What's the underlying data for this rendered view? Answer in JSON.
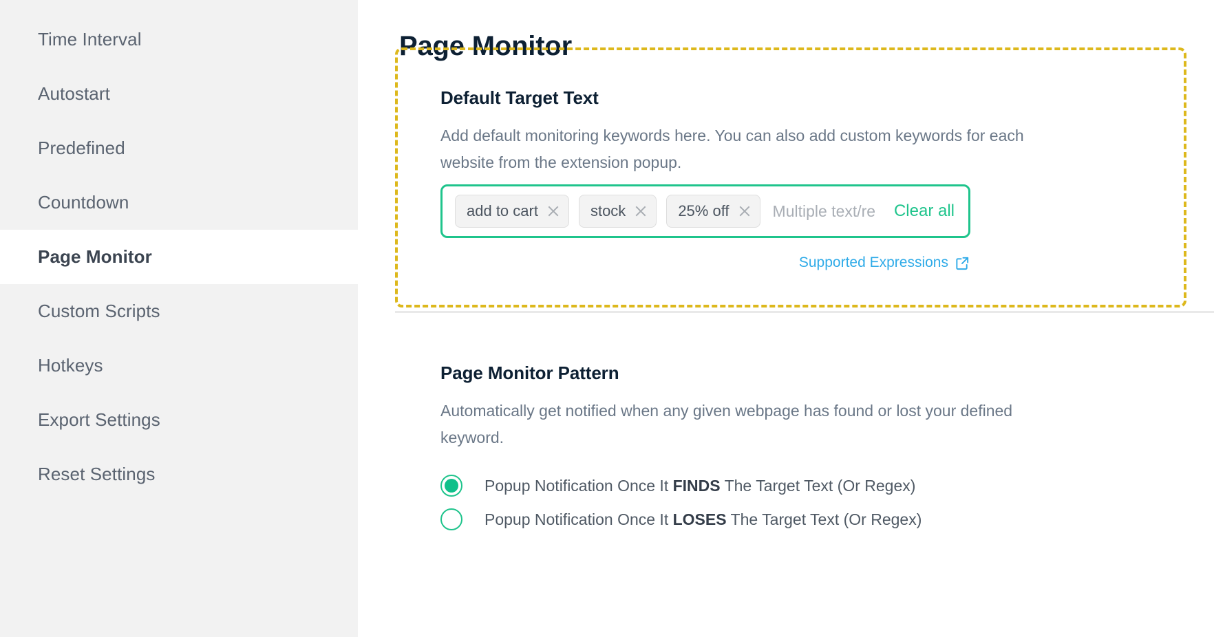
{
  "sidebar": {
    "items": [
      {
        "label": "Time Interval",
        "active": false
      },
      {
        "label": "Autostart",
        "active": false
      },
      {
        "label": "Predefined",
        "active": false
      },
      {
        "label": "Countdown",
        "active": false
      },
      {
        "label": "Page Monitor",
        "active": true
      },
      {
        "label": "Custom Scripts",
        "active": false
      },
      {
        "label": "Hotkeys",
        "active": false
      },
      {
        "label": "Export Settings",
        "active": false
      },
      {
        "label": "Reset Settings",
        "active": false
      }
    ]
  },
  "main": {
    "page_title": "Page Monitor",
    "default_target": {
      "heading": "Default Target Text",
      "description": "Add default monitoring keywords here. You can also add custom keywords for each website from the extension popup.",
      "tags": [
        "add to cart",
        "stock",
        "25% off"
      ],
      "remove_icon": "close-icon",
      "input_placeholder": "Multiple text/re",
      "input_value": "",
      "clear_all_label": "Clear all",
      "supported_expressions_label": "Supported Expressions",
      "supported_expressions_icon": "external-link-icon"
    },
    "pattern": {
      "heading": "Page Monitor Pattern",
      "description": "Automatically get notified when any given webpage has found or lost your defined keyword.",
      "options": [
        {
          "prefix": "Popup Notification Once It ",
          "emphasis": "FINDS",
          "suffix": " The Target Text (Or Regex)",
          "selected": true
        },
        {
          "prefix": "Popup Notification Once It ",
          "emphasis": "LOSES",
          "suffix": " The Target Text (Or Regex)",
          "selected": false
        }
      ]
    }
  },
  "colors": {
    "accent_green": "#1fc48c",
    "highlight_yellow": "#ddb81c",
    "link_blue": "#2fabe8",
    "title_navy": "#0d2033",
    "sidebar_bg": "#f2f2f2"
  }
}
